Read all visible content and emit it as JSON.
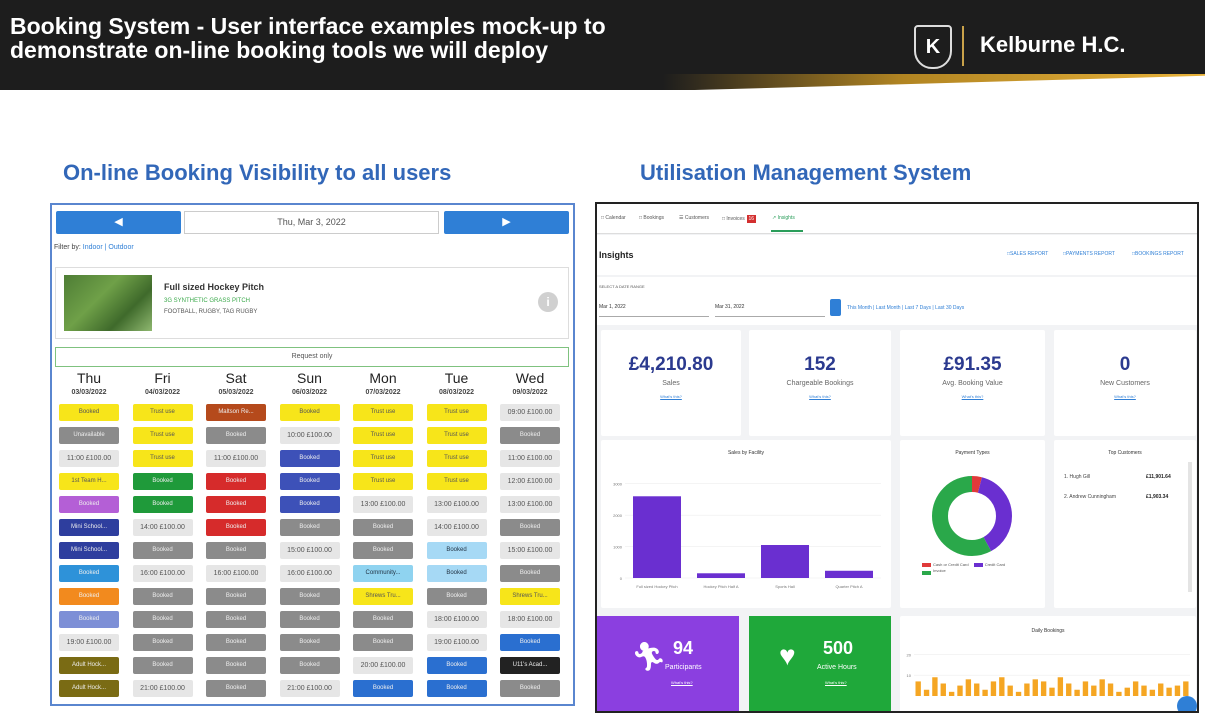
{
  "banner": {
    "title_line1": "Booking System  -  User interface examples mock-up to",
    "title_line2": "demonstrate on-line booking tools we will deploy",
    "brand": "Kelburne H.C.",
    "crest_letter": "K"
  },
  "sections": {
    "left_title": "On-line Booking Visibility to all users",
    "right_title": "Utilisation Management System"
  },
  "booking": {
    "prev_icon": "chevron-left-icon",
    "next_icon": "chevron-right-icon",
    "current_date": "Thu, Mar 3, 2022",
    "filter_label": "Filter by:",
    "filter_indoor": "Indoor",
    "filter_sep": " | ",
    "filter_outdoor": "Outdoor",
    "facility": {
      "name": "Full sized Hockey Pitch",
      "type": "3G SYNTHETIC GRASS PITCH",
      "sports": "FOOTBALL, RUGBY, TAG RUGBY",
      "info_icon": "i"
    },
    "request_label": "Request only",
    "days": [
      {
        "name": "Thu",
        "date": "03/03/2022",
        "slots": [
          {
            "t": "Booked",
            "c": "s-yellow"
          },
          {
            "t": "Unavailable",
            "c": "s-grey"
          },
          {
            "t": "11:00 £100.00",
            "c": "s-free"
          },
          {
            "t": "1st Team H...",
            "c": "s-yellow"
          },
          {
            "t": "Booked",
            "c": "s-purple"
          },
          {
            "t": "Mini School...",
            "c": "s-navy"
          },
          {
            "t": "Mini School...",
            "c": "s-navy"
          },
          {
            "t": "Booked",
            "c": "s-sky"
          },
          {
            "t": "Booked",
            "c": "s-orange"
          },
          {
            "t": "Booked",
            "c": "s-lav"
          },
          {
            "t": "19:00 £100.00",
            "c": "s-free"
          },
          {
            "t": "Adult Hock...",
            "c": "s-olive"
          },
          {
            "t": "Adult Hock...",
            "c": "s-olive"
          }
        ]
      },
      {
        "name": "Fri",
        "date": "04/03/2022",
        "slots": [
          {
            "t": "Trust use",
            "c": "s-yellow"
          },
          {
            "t": "Trust use",
            "c": "s-yellow"
          },
          {
            "t": "Trust use",
            "c": "s-yellow"
          },
          {
            "t": "Booked",
            "c": "s-green"
          },
          {
            "t": "Booked",
            "c": "s-green"
          },
          {
            "t": "14:00 £100.00",
            "c": "s-free"
          },
          {
            "t": "Booked",
            "c": "s-grey"
          },
          {
            "t": "16:00 £100.00",
            "c": "s-free"
          },
          {
            "t": "Booked",
            "c": "s-grey"
          },
          {
            "t": "Booked",
            "c": "s-grey"
          },
          {
            "t": "Booked",
            "c": "s-grey"
          },
          {
            "t": "Booked",
            "c": "s-grey"
          },
          {
            "t": "21:00 £100.00",
            "c": "s-free"
          }
        ]
      },
      {
        "name": "Sat",
        "date": "05/03/2022",
        "slots": [
          {
            "t": "Maltson Re...",
            "c": "s-brown"
          },
          {
            "t": "Booked",
            "c": "s-grey"
          },
          {
            "t": "11:00 £100.00",
            "c": "s-free"
          },
          {
            "t": "Booked",
            "c": "s-red"
          },
          {
            "t": "Booked",
            "c": "s-red"
          },
          {
            "t": "Booked",
            "c": "s-red"
          },
          {
            "t": "Booked",
            "c": "s-grey"
          },
          {
            "t": "16:00 £100.00",
            "c": "s-free"
          },
          {
            "t": "Booked",
            "c": "s-grey"
          },
          {
            "t": "Booked",
            "c": "s-grey"
          },
          {
            "t": "Booked",
            "c": "s-grey"
          },
          {
            "t": "Booked",
            "c": "s-grey"
          },
          {
            "t": "Booked",
            "c": "s-grey"
          }
        ]
      },
      {
        "name": "Sun",
        "date": "06/03/2022",
        "slots": [
          {
            "t": "Booked",
            "c": "s-yellow"
          },
          {
            "t": "10:00 £100.00",
            "c": "s-free"
          },
          {
            "t": "Booked",
            "c": "s-blue"
          },
          {
            "t": "Booked",
            "c": "s-blue"
          },
          {
            "t": "Booked",
            "c": "s-blue"
          },
          {
            "t": "Booked",
            "c": "s-grey"
          },
          {
            "t": "15:00 £100.00",
            "c": "s-free"
          },
          {
            "t": "16:00 £100.00",
            "c": "s-free"
          },
          {
            "t": "Booked",
            "c": "s-grey"
          },
          {
            "t": "Booked",
            "c": "s-grey"
          },
          {
            "t": "Booked",
            "c": "s-grey"
          },
          {
            "t": "Booked",
            "c": "s-grey"
          },
          {
            "t": "21:00 £100.00",
            "c": "s-free"
          }
        ]
      },
      {
        "name": "Mon",
        "date": "07/03/2022",
        "slots": [
          {
            "t": "Trust use",
            "c": "s-yellow"
          },
          {
            "t": "Trust use",
            "c": "s-yellow"
          },
          {
            "t": "Trust use",
            "c": "s-yellow"
          },
          {
            "t": "Trust use",
            "c": "s-yellow"
          },
          {
            "t": "13:00 £100.00",
            "c": "s-free"
          },
          {
            "t": "Booked",
            "c": "s-grey"
          },
          {
            "t": "Booked",
            "c": "s-grey"
          },
          {
            "t": "Community...",
            "c": "s-cyan"
          },
          {
            "t": "Shrews Tru...",
            "c": "s-yellow"
          },
          {
            "t": "Booked",
            "c": "s-grey"
          },
          {
            "t": "Booked",
            "c": "s-grey"
          },
          {
            "t": "20:00 £100.00",
            "c": "s-free"
          },
          {
            "t": "Booked",
            "c": "s-dblue"
          }
        ]
      },
      {
        "name": "Tue",
        "date": "08/03/2022",
        "slots": [
          {
            "t": "Trust use",
            "c": "s-yellow"
          },
          {
            "t": "Trust use",
            "c": "s-yellow"
          },
          {
            "t": "Trust use",
            "c": "s-yellow"
          },
          {
            "t": "Trust use",
            "c": "s-yellow"
          },
          {
            "t": "13:00 £100.00",
            "c": "s-free"
          },
          {
            "t": "14:00 £100.00",
            "c": "s-free"
          },
          {
            "t": "Booked",
            "c": "s-lcyan"
          },
          {
            "t": "Booked",
            "c": "s-lcyan"
          },
          {
            "t": "Booked",
            "c": "s-grey"
          },
          {
            "t": "18:00 £100.00",
            "c": "s-free"
          },
          {
            "t": "19:00 £100.00",
            "c": "s-free"
          },
          {
            "t": "Booked",
            "c": "s-dblue"
          },
          {
            "t": "Booked",
            "c": "s-dblue"
          }
        ]
      },
      {
        "name": "Wed",
        "date": "09/03/2022",
        "slots": [
          {
            "t": "09:00 £100.00",
            "c": "s-free"
          },
          {
            "t": "Booked",
            "c": "s-grey"
          },
          {
            "t": "11:00 £100.00",
            "c": "s-free"
          },
          {
            "t": "12:00 £100.00",
            "c": "s-free"
          },
          {
            "t": "13:00 £100.00",
            "c": "s-free"
          },
          {
            "t": "Booked",
            "c": "s-grey"
          },
          {
            "t": "15:00 £100.00",
            "c": "s-free"
          },
          {
            "t": "Booked",
            "c": "s-grey"
          },
          {
            "t": "Shrews Tru...",
            "c": "s-yellow"
          },
          {
            "t": "18:00 £100.00",
            "c": "s-free"
          },
          {
            "t": "Booked",
            "c": "s-dblue"
          },
          {
            "t": "U11's Acad...",
            "c": "s-black"
          },
          {
            "t": "Booked",
            "c": "s-grey"
          }
        ]
      }
    ]
  },
  "mgmt": {
    "tabs": [
      "Calendar",
      "Bookings",
      "Customers",
      "Invoices",
      "Insights"
    ],
    "invoice_badge": "16",
    "title": "Insights",
    "report_buttons": [
      "SALES REPORT",
      "PAYMENTS REPORT",
      "BOOKINGS REPORT"
    ],
    "date_range_label": "SELECT A DATE RANGE",
    "date_from": "Mar 1, 2022",
    "date_to": "Mar 31, 2022",
    "quick_ranges": "This Month | Last Month | Last 7 Days | Last 30 Days",
    "kpis": [
      {
        "value": "£4,210.80",
        "label": "Sales",
        "link": "What's this?"
      },
      {
        "value": "152",
        "label": "Chargeable Bookings",
        "link": "What's this?"
      },
      {
        "value": "£91.35",
        "label": "Avg. Booking Value",
        "link": "What's this?"
      },
      {
        "value": "0",
        "label": "New Customers",
        "link": "What's this?"
      }
    ],
    "sales_chart_title": "Sales by Facility",
    "payment_chart_title": "Payment Types",
    "payment_legend": [
      "Cash or Credit Card",
      "Credit Card",
      "Invoice"
    ],
    "top_customers_title": "Top Customers",
    "top_customers": [
      {
        "name": "1. Hugh Gill",
        "value": "£11,901.64"
      },
      {
        "name": "2. Andrew Cunningham",
        "value": "£1,903.34"
      }
    ],
    "tiles": [
      {
        "value": "94",
        "label": "Participants",
        "link": "What's this?",
        "icon": "runner-icon"
      },
      {
        "value": "500",
        "label": "Active Hours",
        "link": "What's this?",
        "icon": "heart-pulse-icon"
      }
    ],
    "daily_title": "Daily Bookings"
  },
  "chart_data": [
    {
      "type": "bar",
      "title": "Sales by Facility",
      "categories": [
        "Full sized Hockey Pitch",
        "Hockey Pitch Half A",
        "Sports Hall",
        "Quarter Pitch A"
      ],
      "values": [
        2600,
        150,
        1050,
        230
      ],
      "yticks": [
        "3000",
        "2000",
        "1000",
        "0"
      ],
      "ylim": [
        0,
        3500
      ],
      "color": "#6a2fd0"
    },
    {
      "type": "pie",
      "title": "Payment Types",
      "labels": [
        "Cash or Credit Card",
        "Credit Card",
        "Invoice"
      ],
      "values": [
        4,
        38,
        58
      ],
      "colors": [
        "#e03a3a",
        "#6a2fd0",
        "#2aa84a"
      ]
    },
    {
      "type": "bar",
      "title": "Daily Bookings",
      "values": [
        7,
        3,
        9,
        6,
        2,
        5,
        8,
        6,
        3,
        7,
        9,
        5,
        2,
        6,
        8,
        7,
        4,
        9,
        6,
        3,
        7,
        5,
        8,
        6,
        2,
        4,
        7,
        5,
        3,
        6,
        4,
        5,
        7
      ],
      "yticks": [
        "20",
        "10"
      ],
      "ylim": [
        0,
        24
      ],
      "color": "#f5a623"
    }
  ]
}
